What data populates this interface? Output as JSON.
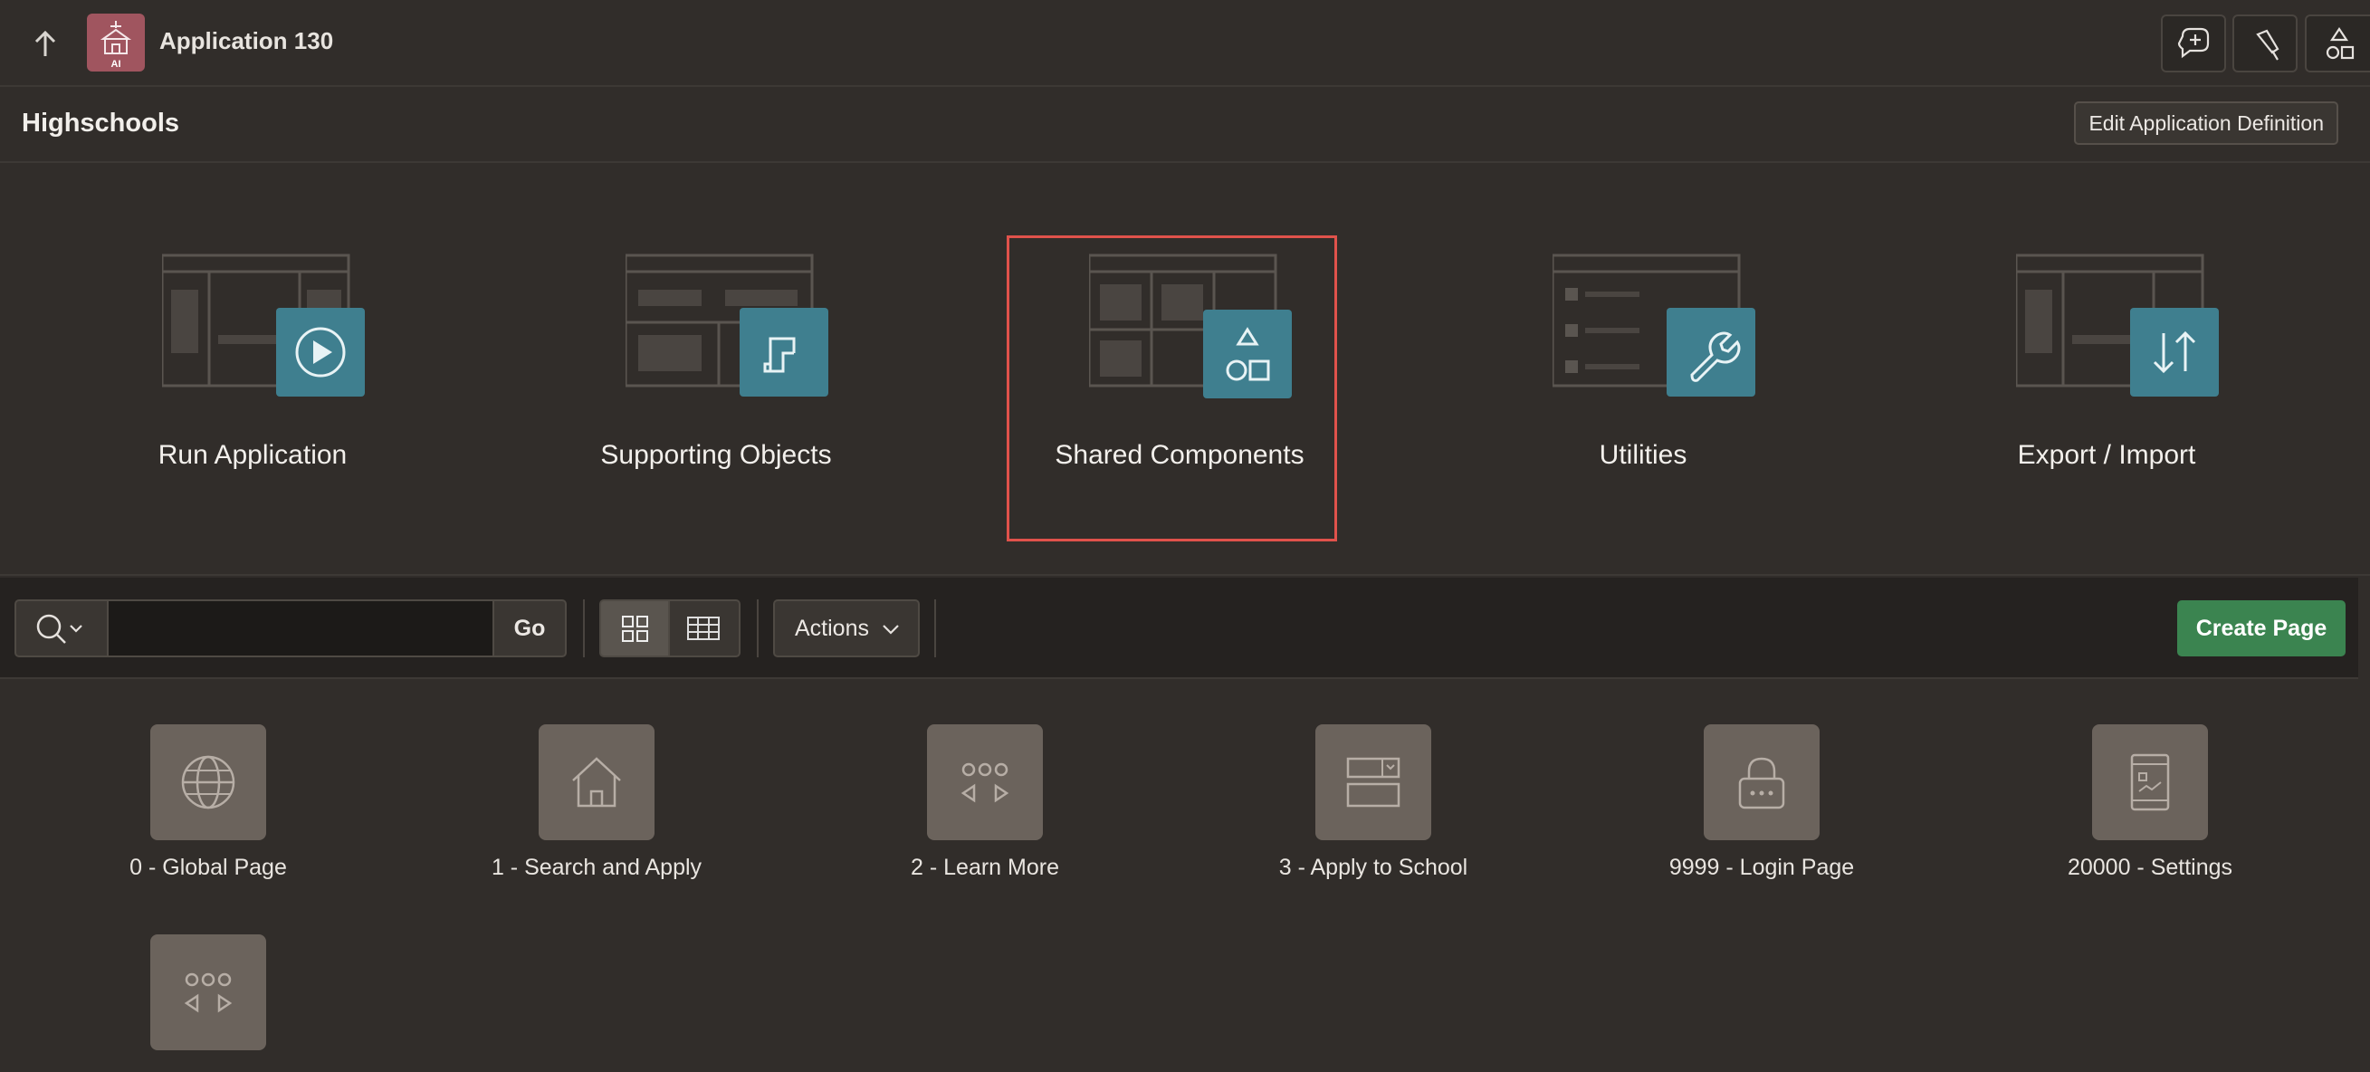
{
  "app": {
    "title": "Application 130",
    "badge_text": "AI"
  },
  "header": {
    "page_title": "Highschools",
    "edit_button": "Edit Application Definition"
  },
  "hero_tiles": [
    {
      "label": "Run Application",
      "icon": "play-icon"
    },
    {
      "label": "Supporting Objects",
      "icon": "scroll-icon"
    },
    {
      "label": "Shared Components",
      "icon": "shapes-icon",
      "highlighted": true
    },
    {
      "label": "Utilities",
      "icon": "wrench-icon"
    },
    {
      "label": "Export / Import",
      "icon": "arrows-updown-icon"
    }
  ],
  "toolbar": {
    "search_value": "",
    "go_label": "Go",
    "actions_label": "Actions",
    "create_label": "Create Page"
  },
  "pages": [
    {
      "label": "0 - Global Page",
      "icon": "globe-icon"
    },
    {
      "label": "1 - Search and Apply",
      "icon": "home-icon"
    },
    {
      "label": "2 - Learn More",
      "icon": "carousel-icon"
    },
    {
      "label": "3 - Apply to School",
      "icon": "form-icon"
    },
    {
      "label": "9999 - Login Page",
      "icon": "lock-icon"
    },
    {
      "label": "20000 - Settings",
      "icon": "settings-page-icon"
    },
    {
      "label": "",
      "icon": "carousel-icon"
    }
  ],
  "colors": {
    "background": "#312d2a",
    "tile_accent": "#3f7f8f",
    "highlight": "#e0524b",
    "create_button": "#3b8450",
    "app_badge": "#a0555f"
  }
}
